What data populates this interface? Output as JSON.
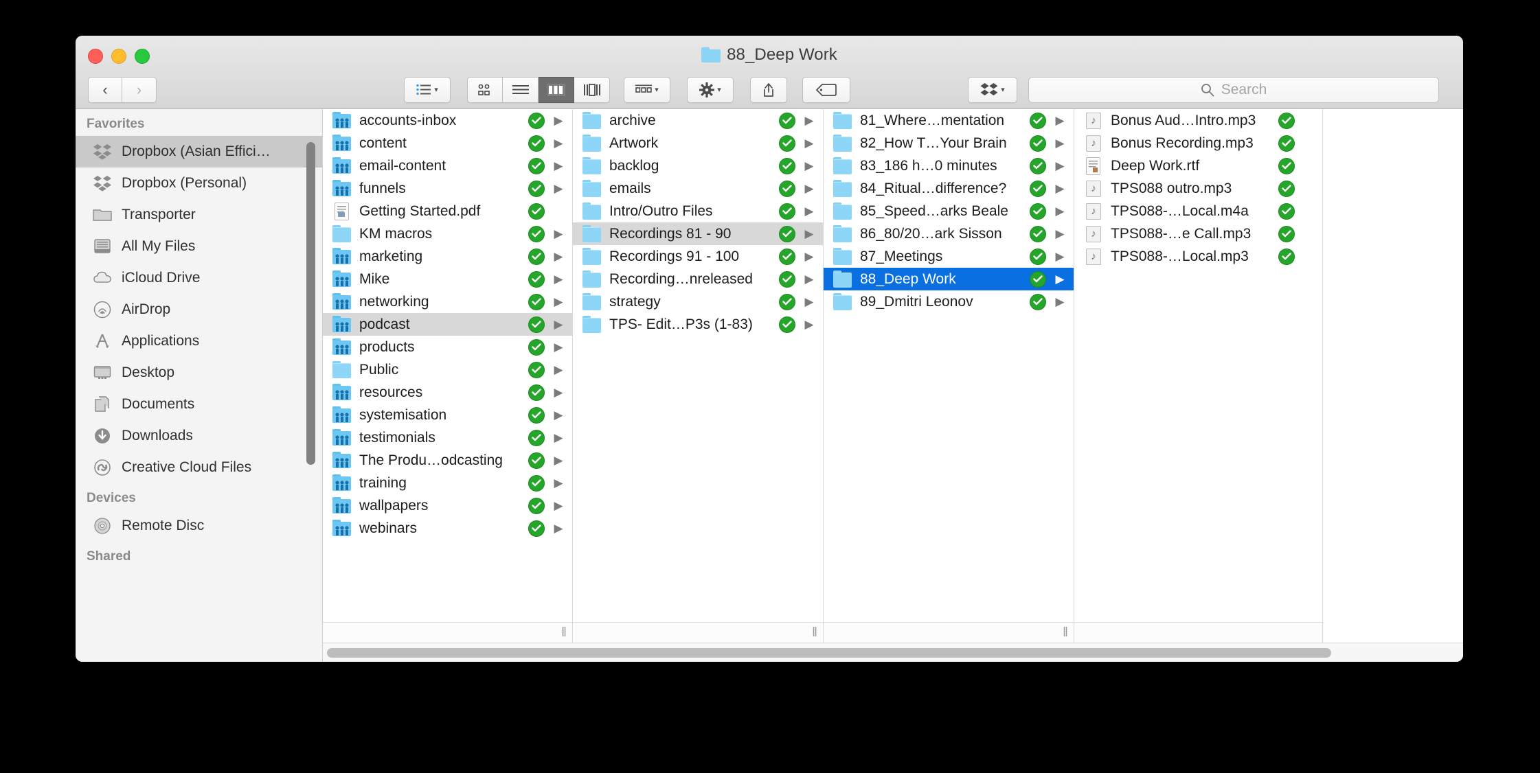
{
  "window": {
    "title": "88_Deep Work",
    "title_icon": "folder-icon",
    "traffic_lights": [
      "close-button",
      "minimize-button",
      "zoom-button"
    ]
  },
  "toolbar": {
    "back_label": "‹",
    "forward_label": "›",
    "arrange_label": "arrange-icon",
    "view_icon_label": "icon-view",
    "view_list_label": "list-view",
    "view_column_label": "column-view",
    "view_gallery_label": "gallery-view",
    "group_label": "group-icon",
    "action_label": "gear-icon",
    "share_label": "share-icon",
    "tag_label": "tag-icon",
    "dropbox_label": "dropbox-icon"
  },
  "search": {
    "placeholder": "Search",
    "value": ""
  },
  "sidebar": {
    "sections": [
      {
        "header": "Favorites",
        "items": [
          {
            "label": "Dropbox (Asian Effici…",
            "icon": "dropbox-icon",
            "selected": true
          },
          {
            "label": "Dropbox (Personal)",
            "icon": "dropbox-icon",
            "selected": false
          },
          {
            "label": "Transporter",
            "icon": "folder-icon",
            "selected": false
          },
          {
            "label": "All My Files",
            "icon": "all-my-files-icon",
            "selected": false
          },
          {
            "label": "iCloud Drive",
            "icon": "cloud-icon",
            "selected": false
          },
          {
            "label": "AirDrop",
            "icon": "airdrop-icon",
            "selected": false
          },
          {
            "label": "Applications",
            "icon": "applications-icon",
            "selected": false
          },
          {
            "label": "Desktop",
            "icon": "desktop-icon",
            "selected": false
          },
          {
            "label": "Documents",
            "icon": "documents-icon",
            "selected": false
          },
          {
            "label": "Downloads",
            "icon": "downloads-icon",
            "selected": false
          },
          {
            "label": "Creative Cloud Files",
            "icon": "creative-cloud-icon",
            "selected": false
          }
        ]
      },
      {
        "header": "Devices",
        "items": [
          {
            "label": "Remote Disc",
            "icon": "disc-icon",
            "selected": false
          }
        ]
      },
      {
        "header": "Shared",
        "items": []
      }
    ]
  },
  "columns": [
    {
      "name": "column-1",
      "rows": [
        {
          "label": "accounts-inbox",
          "icon": "shared-folder-icon",
          "badge": "sync-ok",
          "disclosure": true,
          "selection": "none"
        },
        {
          "label": "content",
          "icon": "shared-folder-icon",
          "badge": "sync-ok",
          "disclosure": true,
          "selection": "none"
        },
        {
          "label": "email-content",
          "icon": "shared-folder-icon",
          "badge": "sync-ok",
          "disclosure": true,
          "selection": "none"
        },
        {
          "label": "funnels",
          "icon": "shared-folder-icon",
          "badge": "sync-ok",
          "disclosure": true,
          "selection": "none"
        },
        {
          "label": "Getting Started.pdf",
          "icon": "pdf-icon",
          "badge": "sync-ok",
          "disclosure": false,
          "selection": "none"
        },
        {
          "label": "KM macros",
          "icon": "folder-icon",
          "badge": "sync-ok",
          "disclosure": true,
          "selection": "none"
        },
        {
          "label": "marketing",
          "icon": "shared-folder-icon",
          "badge": "sync-ok",
          "disclosure": true,
          "selection": "none"
        },
        {
          "label": "Mike",
          "icon": "shared-folder-icon",
          "badge": "sync-ok",
          "disclosure": true,
          "selection": "none"
        },
        {
          "label": "networking",
          "icon": "shared-folder-icon",
          "badge": "sync-ok",
          "disclosure": true,
          "selection": "none"
        },
        {
          "label": "podcast",
          "icon": "shared-folder-icon",
          "badge": "sync-ok",
          "disclosure": true,
          "selection": "inactive"
        },
        {
          "label": "products",
          "icon": "shared-folder-icon",
          "badge": "sync-ok",
          "disclosure": true,
          "selection": "none"
        },
        {
          "label": "Public",
          "icon": "folder-icon",
          "badge": "sync-ok",
          "disclosure": true,
          "selection": "none"
        },
        {
          "label": "resources",
          "icon": "shared-folder-icon",
          "badge": "sync-ok",
          "disclosure": true,
          "selection": "none"
        },
        {
          "label": "systemisation",
          "icon": "shared-folder-icon",
          "badge": "sync-ok",
          "disclosure": true,
          "selection": "none"
        },
        {
          "label": "testimonials",
          "icon": "shared-folder-icon",
          "badge": "sync-ok",
          "disclosure": true,
          "selection": "none"
        },
        {
          "label": "The Produ…odcasting",
          "icon": "shared-folder-icon",
          "badge": "sync-ok",
          "disclosure": true,
          "selection": "none"
        },
        {
          "label": "training",
          "icon": "shared-folder-icon",
          "badge": "sync-ok",
          "disclosure": true,
          "selection": "none"
        },
        {
          "label": "wallpapers",
          "icon": "shared-folder-icon",
          "badge": "sync-ok",
          "disclosure": true,
          "selection": "none"
        },
        {
          "label": "webinars",
          "icon": "shared-folder-icon",
          "badge": "sync-ok",
          "disclosure": true,
          "selection": "none"
        }
      ]
    },
    {
      "name": "column-2",
      "rows": [
        {
          "label": "archive",
          "icon": "folder-icon",
          "badge": "sync-ok",
          "disclosure": true,
          "selection": "none"
        },
        {
          "label": "Artwork",
          "icon": "folder-icon",
          "badge": "sync-ok",
          "disclosure": true,
          "selection": "none"
        },
        {
          "label": "backlog",
          "icon": "folder-icon",
          "badge": "sync-ok",
          "disclosure": true,
          "selection": "none"
        },
        {
          "label": "emails",
          "icon": "folder-icon",
          "badge": "sync-ok",
          "disclosure": true,
          "selection": "none"
        },
        {
          "label": "Intro/Outro Files",
          "icon": "folder-icon",
          "badge": "sync-ok",
          "disclosure": true,
          "selection": "none"
        },
        {
          "label": "Recordings 81 - 90",
          "icon": "folder-icon",
          "badge": "sync-ok",
          "disclosure": true,
          "selection": "inactive"
        },
        {
          "label": "Recordings 91 - 100",
          "icon": "folder-icon",
          "badge": "sync-ok",
          "disclosure": true,
          "selection": "none"
        },
        {
          "label": "Recording…nreleased",
          "icon": "folder-icon",
          "badge": "sync-ok",
          "disclosure": true,
          "selection": "none"
        },
        {
          "label": "strategy",
          "icon": "folder-icon",
          "badge": "sync-ok",
          "disclosure": true,
          "selection": "none"
        },
        {
          "label": "TPS- Edit…P3s (1-83)",
          "icon": "folder-icon",
          "badge": "sync-ok",
          "disclosure": true,
          "selection": "none"
        }
      ]
    },
    {
      "name": "column-3",
      "rows": [
        {
          "label": "81_Where…mentation",
          "icon": "folder-icon",
          "badge": "sync-ok",
          "disclosure": true,
          "selection": "none"
        },
        {
          "label": "82_How T…Your Brain",
          "icon": "folder-icon",
          "badge": "sync-ok",
          "disclosure": true,
          "selection": "none"
        },
        {
          "label": "83_186 h…0 minutes",
          "icon": "folder-icon",
          "badge": "sync-ok",
          "disclosure": true,
          "selection": "none"
        },
        {
          "label": "84_Ritual…difference?",
          "icon": "folder-icon",
          "badge": "sync-ok",
          "disclosure": true,
          "selection": "none"
        },
        {
          "label": "85_Speed…arks Beale",
          "icon": "folder-icon",
          "badge": "sync-ok",
          "disclosure": true,
          "selection": "none"
        },
        {
          "label": "86_80/20…ark Sisson",
          "icon": "folder-icon",
          "badge": "sync-ok",
          "disclosure": true,
          "selection": "none"
        },
        {
          "label": "87_Meetings",
          "icon": "folder-icon",
          "badge": "sync-ok",
          "disclosure": true,
          "selection": "none"
        },
        {
          "label": "88_Deep Work",
          "icon": "folder-icon",
          "badge": "sync-ok",
          "disclosure": true,
          "selection": "active"
        },
        {
          "label": "89_Dmitri Leonov",
          "icon": "folder-icon",
          "badge": "sync-ok",
          "disclosure": true,
          "selection": "none"
        }
      ]
    },
    {
      "name": "column-4",
      "rows": [
        {
          "label": "Bonus Aud…Intro.mp3",
          "icon": "music-icon",
          "badge": "sync-ok",
          "disclosure": false,
          "selection": "none"
        },
        {
          "label": "Bonus Recording.mp3",
          "icon": "music-icon",
          "badge": "sync-ok",
          "disclosure": false,
          "selection": "none"
        },
        {
          "label": "Deep Work.rtf",
          "icon": "rtf-icon",
          "badge": "sync-ok",
          "disclosure": false,
          "selection": "none"
        },
        {
          "label": "TPS088 outro.mp3",
          "icon": "music-icon",
          "badge": "sync-ok",
          "disclosure": false,
          "selection": "none"
        },
        {
          "label": "TPS088-…Local.m4a",
          "icon": "music-icon",
          "badge": "sync-ok",
          "disclosure": false,
          "selection": "none"
        },
        {
          "label": "TPS088-…e Call.mp3",
          "icon": "music-icon",
          "badge": "sync-ok",
          "disclosure": false,
          "selection": "none"
        },
        {
          "label": "TPS088-…Local.mp3",
          "icon": "music-icon",
          "badge": "sync-ok",
          "disclosure": false,
          "selection": "none"
        }
      ]
    }
  ],
  "colors": {
    "accent_selection": "#0a6fe0",
    "sync_badge_green": "#25a52a",
    "folder_blue": "#8ed6f7",
    "inactive_selection": "#d8d8d8"
  }
}
